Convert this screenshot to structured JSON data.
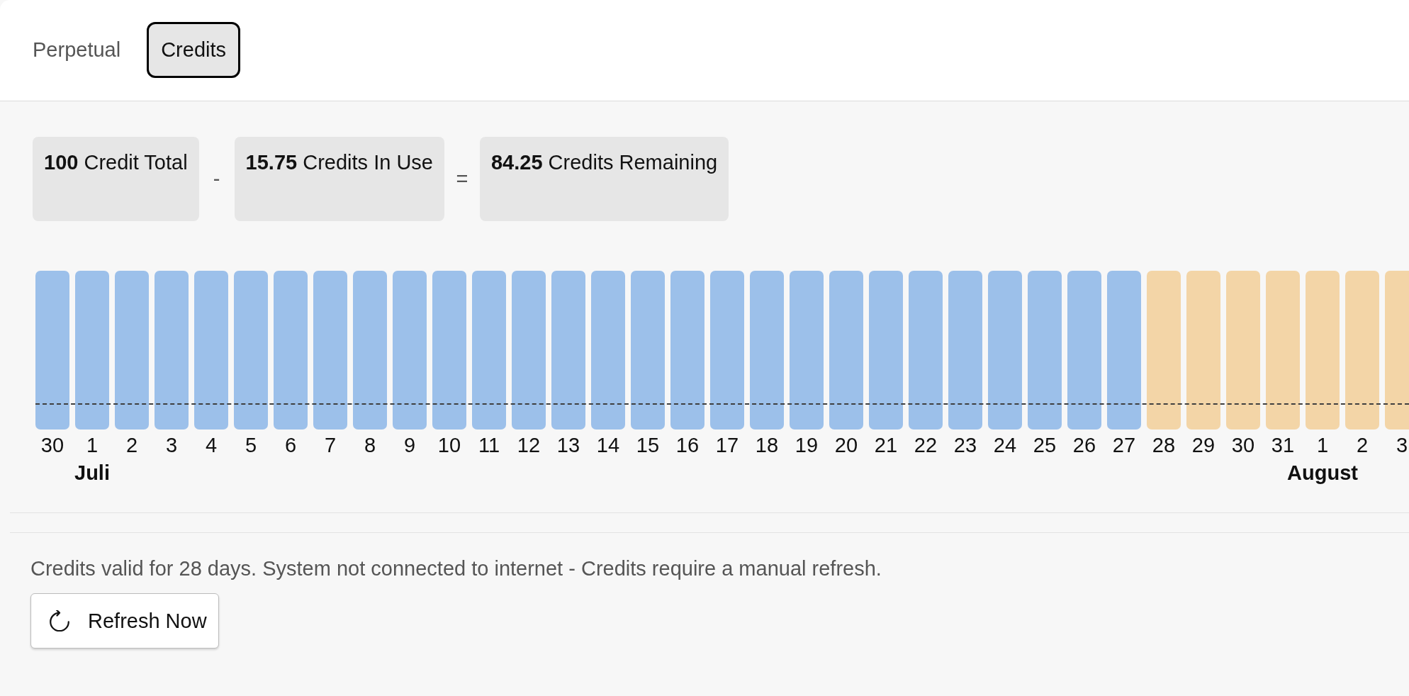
{
  "tabs": [
    {
      "label": "Perpetual",
      "selected": false
    },
    {
      "label": "Credits",
      "selected": true
    }
  ],
  "summary": [
    {
      "kind": "card",
      "text": "**100** Credit Total"
    },
    {
      "kind": "operator",
      "text": "-"
    },
    {
      "kind": "card",
      "text": "**15.75** Credits In Use"
    },
    {
      "kind": "operator",
      "text": "="
    },
    {
      "kind": "card",
      "text": "**84.25** Credits Remaining"
    }
  ],
  "usage_line": {
    "level": 0.16
  },
  "days": [
    {
      "label": "30",
      "color": "#9cc0ea"
    },
    {
      "label": "1",
      "color": "#9cc0ea",
      "month": "Juli"
    },
    {
      "label": "2",
      "color": "#9cc0ea"
    },
    {
      "label": "3",
      "color": "#9cc0ea"
    },
    {
      "label": "4",
      "color": "#9cc0ea"
    },
    {
      "label": "5",
      "color": "#9cc0ea"
    },
    {
      "label": "6",
      "color": "#9cc0ea"
    },
    {
      "label": "7",
      "color": "#9cc0ea"
    },
    {
      "label": "8",
      "color": "#9cc0ea"
    },
    {
      "label": "9",
      "color": "#9cc0ea"
    },
    {
      "label": "10",
      "color": "#9cc0ea"
    },
    {
      "label": "11",
      "color": "#9cc0ea"
    },
    {
      "label": "12",
      "color": "#9cc0ea"
    },
    {
      "label": "13",
      "color": "#9cc0ea"
    },
    {
      "label": "14",
      "color": "#9cc0ea"
    },
    {
      "label": "15",
      "color": "#9cc0ea"
    },
    {
      "label": "16",
      "color": "#9cc0ea"
    },
    {
      "label": "17",
      "color": "#9cc0ea"
    },
    {
      "label": "18",
      "color": "#9cc0ea"
    },
    {
      "label": "19",
      "color": "#9cc0ea"
    },
    {
      "label": "20",
      "color": "#9cc0ea"
    },
    {
      "label": "21",
      "color": "#9cc0ea"
    },
    {
      "label": "22",
      "color": "#9cc0ea"
    },
    {
      "label": "23",
      "color": "#9cc0ea"
    },
    {
      "label": "24",
      "color": "#9cc0ea"
    },
    {
      "label": "25",
      "color": "#9cc0ea"
    },
    {
      "label": "26",
      "color": "#9cc0ea"
    },
    {
      "label": "27",
      "color": "#9cc0ea"
    },
    {
      "label": "28",
      "color": "#f3d5a7"
    },
    {
      "label": "29",
      "color": "#f3d5a7"
    },
    {
      "label": "30",
      "color": "#f3d5a7"
    },
    {
      "label": "31",
      "color": "#f3d5a7"
    },
    {
      "label": "1",
      "color": "#f3d5a7",
      "month": "August"
    },
    {
      "label": "2",
      "color": "#f3d5a7"
    },
    {
      "label": "3",
      "color": "#f3d5a7"
    }
  ],
  "note": "Credits valid for 28 days. System not connected to internet - Credits require a manual refresh.",
  "refresh_button": {
    "label": "Refresh Now"
  }
}
